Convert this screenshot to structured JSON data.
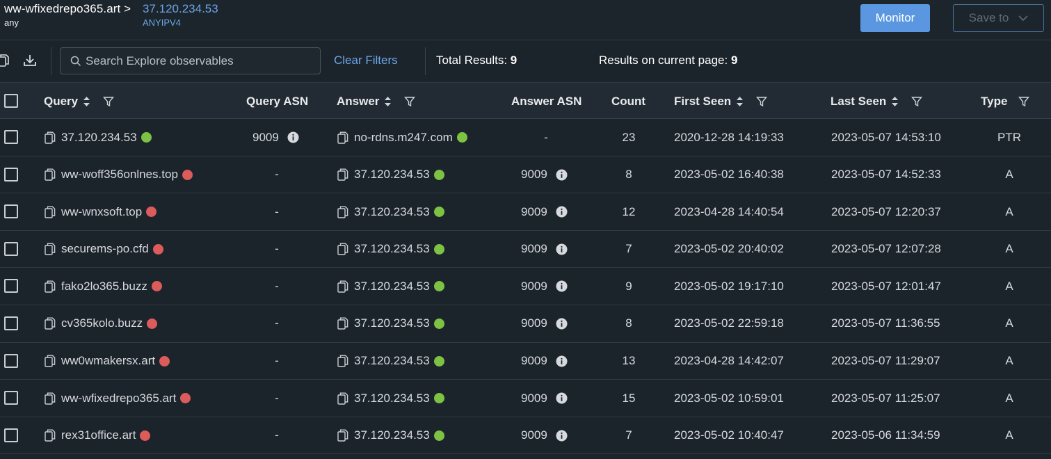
{
  "header": {
    "breadcrumb_domain": "ww-wfixedrepo365.art >",
    "breadcrumb_sub": "any",
    "breadcrumb_ip": "37.120.234.53",
    "breadcrumb_type": "ANYIPV4",
    "monitor_label": "Monitor",
    "save_label": "Save to"
  },
  "toolbar": {
    "search_placeholder": "Search Explore observables",
    "clear_filters": "Clear Filters",
    "total_results_label": "Total Results:",
    "total_results_value": "9",
    "page_results_label": "Results on current page:",
    "page_results_value": "9"
  },
  "table": {
    "columns": {
      "query": "Query",
      "query_asn": "Query ASN",
      "answer": "Answer",
      "answer_asn": "Answer ASN",
      "count": "Count",
      "first_seen": "First Seen",
      "last_seen": "Last Seen",
      "type": "Type"
    },
    "rows": [
      {
        "query": "37.120.234.53",
        "query_status": "green",
        "query_asn": "9009",
        "answer": "no-rdns.m247.com",
        "answer_status": "green",
        "answer_asn": "-",
        "count": "23",
        "first_seen": "2020-12-28 14:19:33",
        "last_seen": "2023-05-07 14:53:10",
        "type": "PTR"
      },
      {
        "query": "ww-woff356onlnes.top",
        "query_status": "red",
        "query_asn": "-",
        "answer": "37.120.234.53",
        "answer_status": "green",
        "answer_asn": "9009",
        "count": "8",
        "first_seen": "2023-05-02 16:40:38",
        "last_seen": "2023-05-07 14:52:33",
        "type": "A"
      },
      {
        "query": "ww-wnxsoft.top",
        "query_status": "red",
        "query_asn": "-",
        "answer": "37.120.234.53",
        "answer_status": "green",
        "answer_asn": "9009",
        "count": "12",
        "first_seen": "2023-04-28 14:40:54",
        "last_seen": "2023-05-07 12:20:37",
        "type": "A"
      },
      {
        "query": "securems-po.cfd",
        "query_status": "red",
        "query_asn": "-",
        "answer": "37.120.234.53",
        "answer_status": "green",
        "answer_asn": "9009",
        "count": "7",
        "first_seen": "2023-05-02 20:40:02",
        "last_seen": "2023-05-07 12:07:28",
        "type": "A"
      },
      {
        "query": "fako2lo365.buzz",
        "query_status": "red",
        "query_asn": "-",
        "answer": "37.120.234.53",
        "answer_status": "green",
        "answer_asn": "9009",
        "count": "9",
        "first_seen": "2023-05-02 19:17:10",
        "last_seen": "2023-05-07 12:01:47",
        "type": "A"
      },
      {
        "query": "cv365kolo.buzz",
        "query_status": "red",
        "query_asn": "-",
        "answer": "37.120.234.53",
        "answer_status": "green",
        "answer_asn": "9009",
        "count": "8",
        "first_seen": "2023-05-02 22:59:18",
        "last_seen": "2023-05-07 11:36:55",
        "type": "A"
      },
      {
        "query": "ww0wmakersx.art",
        "query_status": "red",
        "query_asn": "-",
        "answer": "37.120.234.53",
        "answer_status": "green",
        "answer_asn": "9009",
        "count": "13",
        "first_seen": "2023-04-28 14:42:07",
        "last_seen": "2023-05-07 11:29:07",
        "type": "A"
      },
      {
        "query": "ww-wfixedrepo365.art",
        "query_status": "red",
        "query_asn": "-",
        "answer": "37.120.234.53",
        "answer_status": "green",
        "answer_asn": "9009",
        "count": "15",
        "first_seen": "2023-05-02 10:59:01",
        "last_seen": "2023-05-07 11:25:07",
        "type": "A"
      },
      {
        "query": "rex31office.art",
        "query_status": "red",
        "query_asn": "-",
        "answer": "37.120.234.53",
        "answer_status": "green",
        "answer_asn": "9009",
        "count": "7",
        "first_seen": "2023-05-02 10:40:47",
        "last_seen": "2023-05-06 11:34:59",
        "type": "A"
      }
    ]
  },
  "icons": {
    "copy": "copy-icon",
    "download": "download-icon",
    "search": "search-icon",
    "sort": "sort-icon",
    "filter": "filter-icon",
    "info": "info-icon",
    "chevron": "chevron-down-icon"
  },
  "colors": {
    "accent": "#5b97e1",
    "link": "#6aa6e8",
    "status_green": "#7dc243",
    "status_red": "#dc5b5b",
    "background": "#1c242b"
  }
}
